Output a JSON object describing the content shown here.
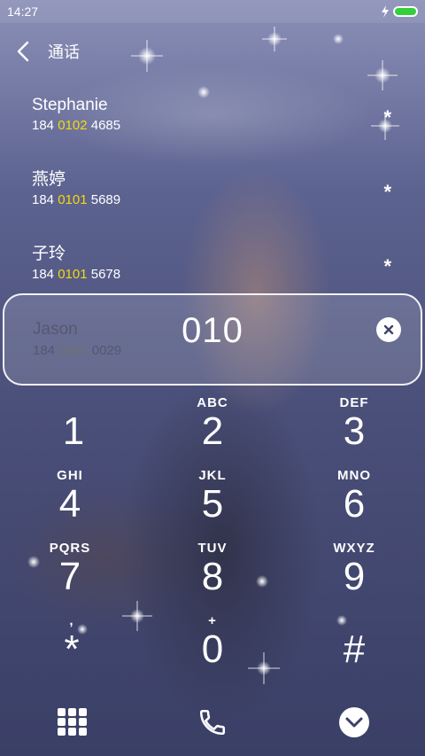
{
  "status_bar": {
    "time": "14:27",
    "battery_color": "#34d03c"
  },
  "header": {
    "title": "通话",
    "back_icon": "chevron-left-icon"
  },
  "contacts": [
    {
      "name": "Stephanie",
      "number_prefix": "184 ",
      "number_match": "0102",
      "number_suffix": " 4685",
      "star": "*"
    },
    {
      "name": "燕婷",
      "number_prefix": "184 ",
      "number_match": "0101",
      "number_suffix": " 5689",
      "star": "*"
    },
    {
      "name": "子玲",
      "number_prefix": "184 ",
      "number_match": "0101",
      "number_suffix": " 5678",
      "star": "*"
    }
  ],
  "search": {
    "query": "010",
    "clear_icon": "close-icon",
    "ghost_contact": {
      "name": "Jason",
      "number_prefix": "184 ",
      "number_match": "0101",
      "number_suffix": " 0029"
    }
  },
  "keypad": [
    {
      "digit": "1",
      "letters": ""
    },
    {
      "digit": "2",
      "letters": "ABC"
    },
    {
      "digit": "3",
      "letters": "DEF"
    },
    {
      "digit": "4",
      "letters": "GHI"
    },
    {
      "digit": "5",
      "letters": "JKL"
    },
    {
      "digit": "6",
      "letters": "MNO"
    },
    {
      "digit": "7",
      "letters": "PQRS"
    },
    {
      "digit": "8",
      "letters": "TUV"
    },
    {
      "digit": "9",
      "letters": "WXYZ"
    },
    {
      "digit": "*",
      "letters": ","
    },
    {
      "digit": "0",
      "letters": "+"
    },
    {
      "digit": "#",
      "letters": ""
    }
  ],
  "bottom_bar": {
    "left_icon": "grid-icon",
    "center_icon": "phone-icon",
    "right_icon": "chevron-down-icon"
  },
  "colors": {
    "highlight": "#f5d90a"
  }
}
